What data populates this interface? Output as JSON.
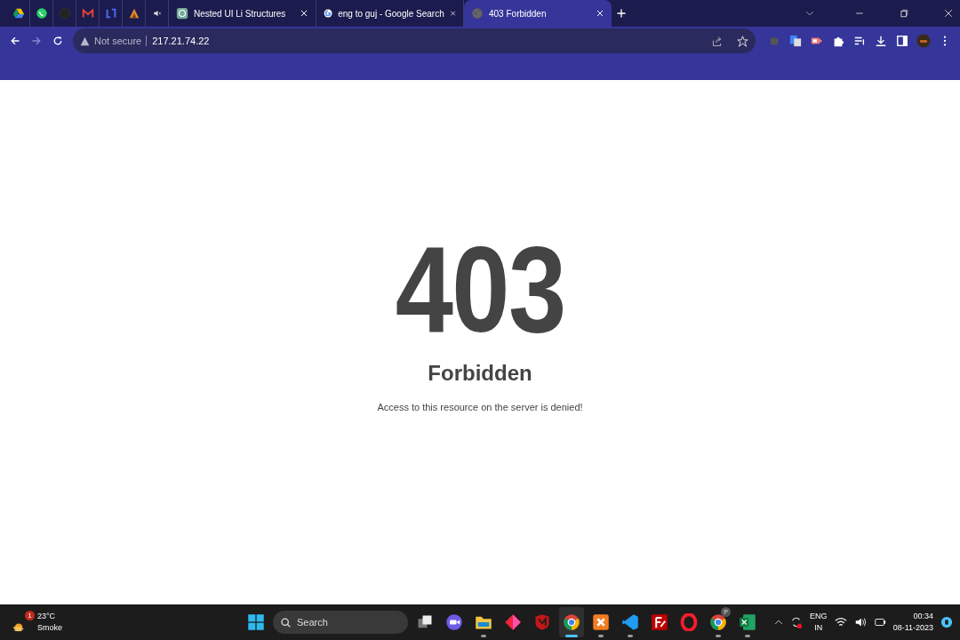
{
  "tabs": [
    {
      "title": "Nested UI Li Structures",
      "kind": "chatbot",
      "selected": false
    },
    {
      "title": "eng to guj - Google Search",
      "kind": "google",
      "selected": false
    },
    {
      "title": "403 Forbidden",
      "kind": "globe",
      "selected": true
    }
  ],
  "address_bar": {
    "security": "Not secure",
    "url": "217.21.74.22"
  },
  "page": {
    "code": "403",
    "title": "Forbidden",
    "message": "Access to this resource on the server is denied!"
  },
  "taskbar": {
    "weather": {
      "badge": "1",
      "temperature": "23°C",
      "condition": "Smoke"
    },
    "search": {
      "placeholder": "Search"
    },
    "apps": [
      {
        "kind": "taskview",
        "running": false,
        "selected": false
      },
      {
        "kind": "meet",
        "running": false,
        "selected": false
      },
      {
        "kind": "folder",
        "running": true,
        "selected": false
      },
      {
        "kind": "diamond",
        "running": false,
        "selected": false
      },
      {
        "kind": "shield",
        "running": false,
        "selected": false
      },
      {
        "kind": "chrome",
        "running": true,
        "selected": true
      },
      {
        "kind": "xampp",
        "running": true,
        "selected": false
      },
      {
        "kind": "vscode",
        "running": true,
        "selected": false
      },
      {
        "kind": "filezilla",
        "running": false,
        "selected": false
      },
      {
        "kind": "opera",
        "running": false,
        "selected": false
      },
      {
        "kind": "chrome",
        "running": true,
        "selected": false,
        "badge": "P"
      },
      {
        "kind": "excel",
        "running": true,
        "selected": false
      }
    ],
    "tray": {
      "language": "ENG",
      "region": "IN",
      "time": "00:34",
      "date": "08-11-2023"
    }
  }
}
